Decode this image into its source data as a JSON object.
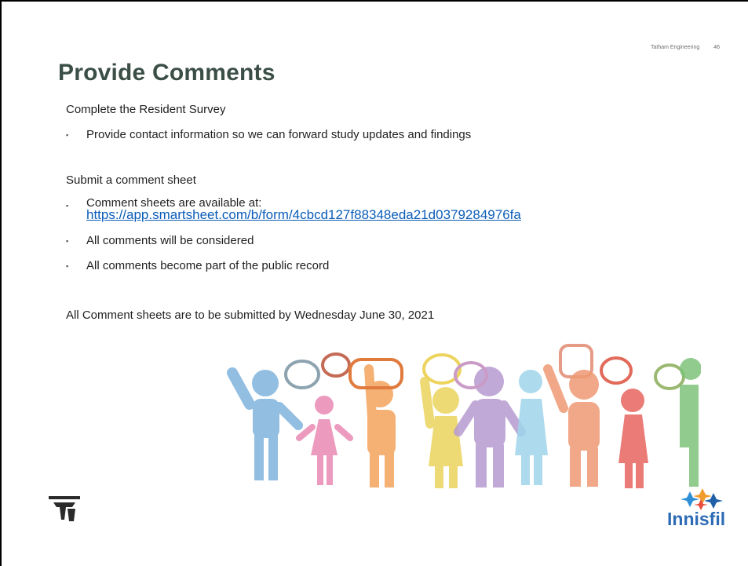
{
  "header": {
    "company": "Tatham Engineering",
    "page_number": "46"
  },
  "title": "Provide Comments",
  "sections": {
    "survey_heading": "Complete the Resident Survey",
    "survey_bullet": "Provide contact information so we can forward study updates and findings",
    "comment_heading": "Submit a comment sheet",
    "comment_bullet_1_text": "Comment sheets are available at:",
    "comment_bullet_1_link": "https://app.smartsheet.com/b/form/4cbcd127f88348eda21d0379284976fa",
    "comment_bullet_2": "All comments will be considered",
    "comment_bullet_3": "All comments become part of the public record",
    "deadline": "All Comment sheets are to be submitted by Wednesday June 30, 2021"
  },
  "logos": {
    "right_logo_text": "Innisfil"
  },
  "colors": {
    "title": "#3b4f46",
    "link": "#0b5db8",
    "logo_blue": "#2d6bb5"
  },
  "icons": {
    "bullet": "square-bullet",
    "illustration": "people-speech-bubbles",
    "left_logo": "tatham-t-logo",
    "right_logo": "innisfil-star-logo"
  }
}
